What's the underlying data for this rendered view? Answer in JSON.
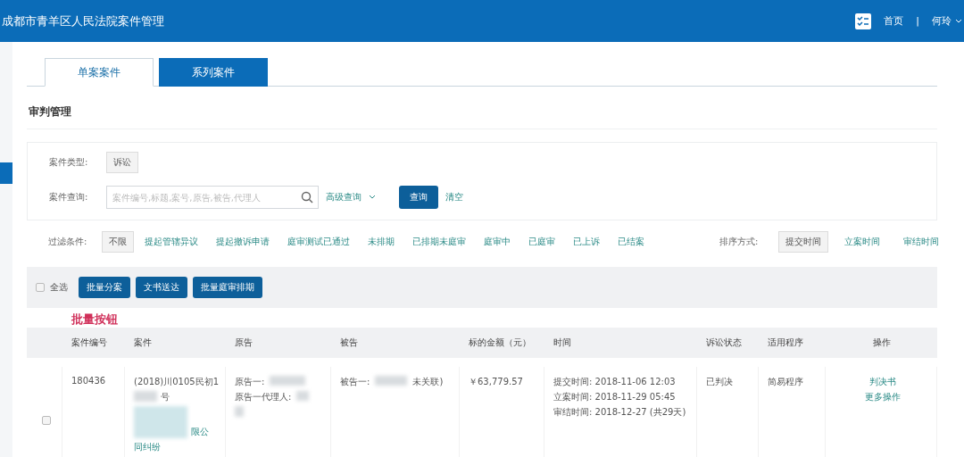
{
  "header": {
    "title": "成都市青羊区人民法院案件管理",
    "home": "首页",
    "separator": "|",
    "user": "何玲"
  },
  "tabs": [
    {
      "label": "单案案件",
      "selected": true
    },
    {
      "label": "系列案件",
      "selected": false
    }
  ],
  "section_title": "审判管理",
  "search": {
    "type_label": "案件类型:",
    "type_value": "诉讼",
    "query_label": "案件查询:",
    "placeholder": "案件编号,标题,案号,原告,被告,代理人",
    "advanced": "高级查询",
    "submit": "查询",
    "clear": "清空"
  },
  "filters": {
    "label": "过滤条件:",
    "items": [
      {
        "label": "不限",
        "selected": true
      },
      {
        "label": "提起管辖异议",
        "selected": false
      },
      {
        "label": "提起撤诉申请",
        "selected": false
      },
      {
        "label": "庭审测试已通过",
        "selected": false
      },
      {
        "label": "未排期",
        "selected": false
      },
      {
        "label": "已排期未庭审",
        "selected": false
      },
      {
        "label": "庭审中",
        "selected": false
      },
      {
        "label": "已庭审",
        "selected": false
      },
      {
        "label": "已上诉",
        "selected": false
      },
      {
        "label": "已结案",
        "selected": false
      }
    ]
  },
  "sort": {
    "label": "排序方式:",
    "items": [
      {
        "label": "提交时间",
        "selected": true
      },
      {
        "label": "立案时间",
        "selected": false
      },
      {
        "label": "审结时间",
        "selected": false
      }
    ]
  },
  "toolbar": {
    "select_all": "全选",
    "checked": false,
    "buttons": [
      "批量分案",
      "文书送达",
      "批量庭审排期"
    ]
  },
  "annotation": "批量按钮",
  "table": {
    "columns": [
      "案件编号",
      "案件",
      "原告",
      "被告",
      "标的金额（元）",
      "时间",
      "诉讼状态",
      "适用程序",
      "操作"
    ],
    "rows": [
      {
        "checked": false,
        "id": "180436",
        "case_lines": [
          "(2018)川0105民初1",
          "号",
          "限公",
          "同纠纷"
        ],
        "plaintiff_lines": [
          "原告一:",
          "原告一代理人:"
        ],
        "defendant": [
          "被告一:",
          "未关联)"
        ],
        "amount": "￥63,779.57",
        "times": [
          "提交时间: 2018-11-06 12:03",
          "立案时间: 2018-11-29 05:45",
          "审结时间: 2018-12-27 (共29天)"
        ],
        "status": "已判决",
        "procedure": "简易程序",
        "actions": [
          "判决书",
          "更多操作"
        ]
      }
    ]
  }
}
